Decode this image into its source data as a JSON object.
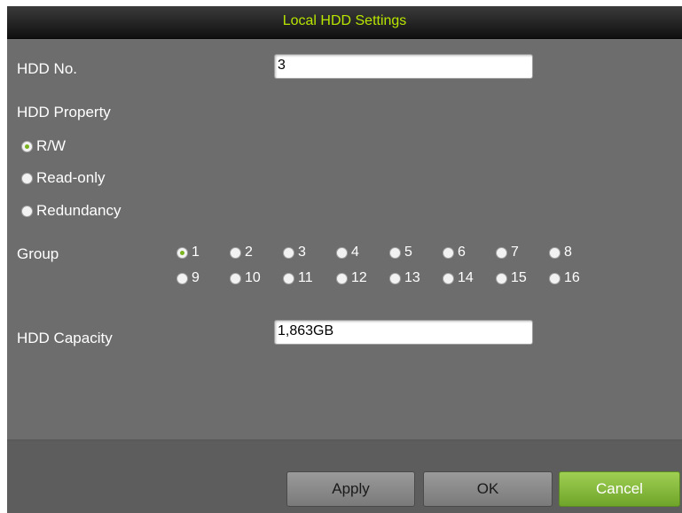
{
  "dialog": {
    "title": "Local HDD Settings"
  },
  "hdd_no": {
    "label": "HDD No.",
    "value": "3"
  },
  "property": {
    "label": "HDD Property",
    "options": [
      {
        "label": "R/W",
        "checked": true
      },
      {
        "label": "Read-only",
        "checked": false
      },
      {
        "label": "Redundancy",
        "checked": false
      }
    ]
  },
  "group": {
    "label": "Group",
    "options": [
      {
        "label": "1",
        "checked": true
      },
      {
        "label": "2",
        "checked": false
      },
      {
        "label": "3",
        "checked": false
      },
      {
        "label": "4",
        "checked": false
      },
      {
        "label": "5",
        "checked": false
      },
      {
        "label": "6",
        "checked": false
      },
      {
        "label": "7",
        "checked": false
      },
      {
        "label": "8",
        "checked": false
      },
      {
        "label": "9",
        "checked": false
      },
      {
        "label": "10",
        "checked": false
      },
      {
        "label": "11",
        "checked": false
      },
      {
        "label": "12",
        "checked": false
      },
      {
        "label": "13",
        "checked": false
      },
      {
        "label": "14",
        "checked": false
      },
      {
        "label": "15",
        "checked": false
      },
      {
        "label": "16",
        "checked": false
      }
    ]
  },
  "capacity": {
    "label": "HDD Capacity",
    "value": "1,863GB"
  },
  "buttons": {
    "apply": "Apply",
    "ok": "OK",
    "cancel": "Cancel"
  },
  "colors": {
    "title_text": "#b8e600",
    "panel_background": "#6d6d6d",
    "selected_radio": "#7ab320",
    "cancel_button": "#8bc043"
  }
}
